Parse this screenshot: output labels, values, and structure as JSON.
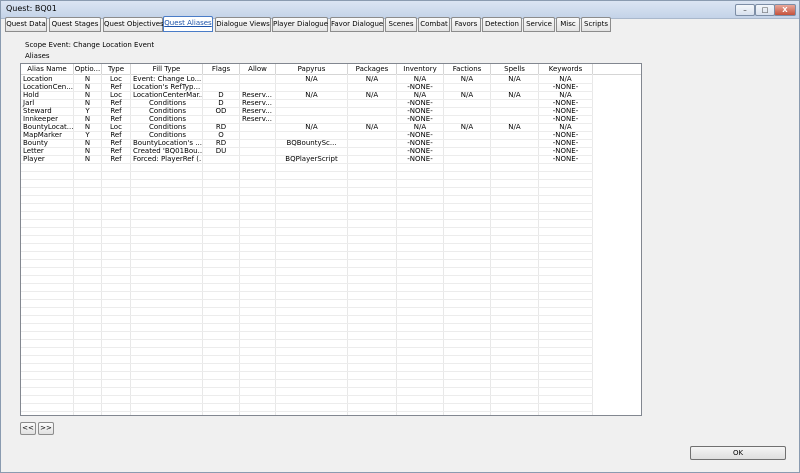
{
  "window": {
    "title": "Quest: BQ01",
    "controls": [
      "–",
      "□",
      "X"
    ]
  },
  "tabs": [
    "Quest Data",
    "Quest Stages",
    "Quest Objectives",
    "Quest Aliases",
    "Dialogue Views",
    "Player Dialogue",
    "Favor Dialogue",
    "Scenes",
    "Combat",
    "Favors",
    "Detection",
    "Service",
    "Misc",
    "Scripts"
  ],
  "active_tab": "Quest Aliases",
  "scope_event": "Scope Event: Change Location Event",
  "aliases_label": "Aliases",
  "columns": [
    "Alias Name",
    "Optio...",
    "Type",
    "Fill Type",
    "Flags",
    "Allow",
    "Papyrus",
    "Packages",
    "Inventory",
    "Factions",
    "Spells",
    "Keywords"
  ],
  "rows": [
    [
      "Location",
      "N",
      "Loc",
      "Event: Change Lo...",
      "",
      "",
      "N/A",
      "N/A",
      "N/A",
      "N/A",
      "N/A",
      "N/A"
    ],
    [
      "LocationCen...",
      "N",
      "Ref",
      "Location's RefTyp...",
      "",
      "",
      "",
      "",
      "-NONE-",
      "",
      "",
      "-NONE-"
    ],
    [
      "Hold",
      "N",
      "Loc",
      "LocationCenterMar...",
      "D",
      "Reserv...",
      "N/A",
      "N/A",
      "N/A",
      "N/A",
      "N/A",
      "N/A"
    ],
    [
      "Jarl",
      "N",
      "Ref",
      "Conditions",
      "D",
      "Reserv...",
      "",
      "",
      "-NONE-",
      "",
      "",
      "-NONE-"
    ],
    [
      "Steward",
      "Y",
      "Ref",
      "Conditions",
      "OD",
      "Reserv...",
      "",
      "",
      "-NONE-",
      "",
      "",
      "-NONE-"
    ],
    [
      "Innkeeper",
      "N",
      "Ref",
      "Conditions",
      "",
      "Reserv...",
      "",
      "",
      "-NONE-",
      "",
      "",
      "-NONE-"
    ],
    [
      "BountyLocat...",
      "N",
      "Loc",
      "Conditions",
      "RD",
      "",
      "N/A",
      "N/A",
      "N/A",
      "N/A",
      "N/A",
      "N/A"
    ],
    [
      "MapMarker",
      "Y",
      "Ref",
      "Conditions",
      "O",
      "",
      "",
      "",
      "-NONE-",
      "",
      "",
      "-NONE-"
    ],
    [
      "Bounty",
      "N",
      "Ref",
      "BountyLocation's ...",
      "RD",
      "",
      "BQBountySc...",
      "",
      "-NONE-",
      "",
      "",
      "-NONE-"
    ],
    [
      "Letter",
      "N",
      "Ref",
      "Created 'BQ01Bou...",
      "DU",
      "",
      "",
      "",
      "-NONE-",
      "",
      "",
      "-NONE-"
    ],
    [
      "Player",
      "N",
      "Ref",
      "Forced: PlayerRef (...",
      "",
      "",
      "BQPlayerScript",
      "",
      "-NONE-",
      "",
      "",
      "-NONE-"
    ]
  ],
  "pager": {
    "prev": "<<",
    "next": ">>"
  },
  "ok_label": "OK"
}
